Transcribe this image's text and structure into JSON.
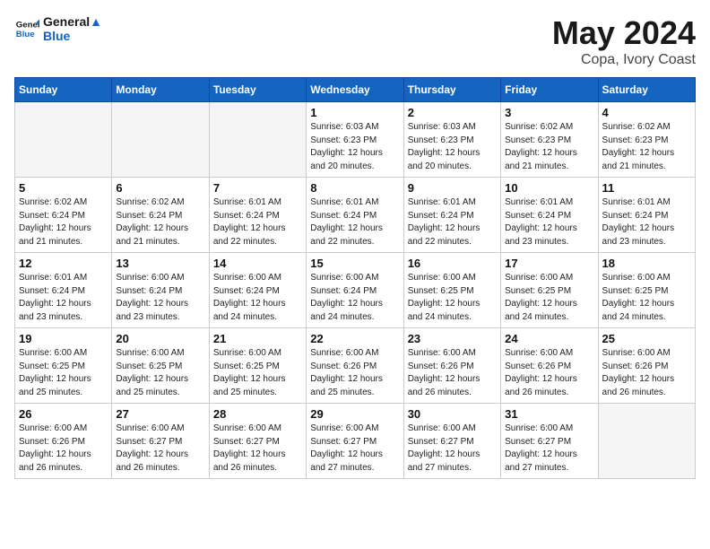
{
  "header": {
    "logo_line1": "General",
    "logo_line2": "Blue",
    "main_title": "May 2024",
    "sub_title": "Copa, Ivory Coast"
  },
  "weekdays": [
    "Sunday",
    "Monday",
    "Tuesday",
    "Wednesday",
    "Thursday",
    "Friday",
    "Saturday"
  ],
  "weeks": [
    [
      {
        "day": "",
        "info": ""
      },
      {
        "day": "",
        "info": ""
      },
      {
        "day": "",
        "info": ""
      },
      {
        "day": "1",
        "info": "Sunrise: 6:03 AM\nSunset: 6:23 PM\nDaylight: 12 hours\nand 20 minutes."
      },
      {
        "day": "2",
        "info": "Sunrise: 6:03 AM\nSunset: 6:23 PM\nDaylight: 12 hours\nand 20 minutes."
      },
      {
        "day": "3",
        "info": "Sunrise: 6:02 AM\nSunset: 6:23 PM\nDaylight: 12 hours\nand 21 minutes."
      },
      {
        "day": "4",
        "info": "Sunrise: 6:02 AM\nSunset: 6:23 PM\nDaylight: 12 hours\nand 21 minutes."
      }
    ],
    [
      {
        "day": "5",
        "info": "Sunrise: 6:02 AM\nSunset: 6:24 PM\nDaylight: 12 hours\nand 21 minutes."
      },
      {
        "day": "6",
        "info": "Sunrise: 6:02 AM\nSunset: 6:24 PM\nDaylight: 12 hours\nand 21 minutes."
      },
      {
        "day": "7",
        "info": "Sunrise: 6:01 AM\nSunset: 6:24 PM\nDaylight: 12 hours\nand 22 minutes."
      },
      {
        "day": "8",
        "info": "Sunrise: 6:01 AM\nSunset: 6:24 PM\nDaylight: 12 hours\nand 22 minutes."
      },
      {
        "day": "9",
        "info": "Sunrise: 6:01 AM\nSunset: 6:24 PM\nDaylight: 12 hours\nand 22 minutes."
      },
      {
        "day": "10",
        "info": "Sunrise: 6:01 AM\nSunset: 6:24 PM\nDaylight: 12 hours\nand 23 minutes."
      },
      {
        "day": "11",
        "info": "Sunrise: 6:01 AM\nSunset: 6:24 PM\nDaylight: 12 hours\nand 23 minutes."
      }
    ],
    [
      {
        "day": "12",
        "info": "Sunrise: 6:01 AM\nSunset: 6:24 PM\nDaylight: 12 hours\nand 23 minutes."
      },
      {
        "day": "13",
        "info": "Sunrise: 6:00 AM\nSunset: 6:24 PM\nDaylight: 12 hours\nand 23 minutes."
      },
      {
        "day": "14",
        "info": "Sunrise: 6:00 AM\nSunset: 6:24 PM\nDaylight: 12 hours\nand 24 minutes."
      },
      {
        "day": "15",
        "info": "Sunrise: 6:00 AM\nSunset: 6:24 PM\nDaylight: 12 hours\nand 24 minutes."
      },
      {
        "day": "16",
        "info": "Sunrise: 6:00 AM\nSunset: 6:25 PM\nDaylight: 12 hours\nand 24 minutes."
      },
      {
        "day": "17",
        "info": "Sunrise: 6:00 AM\nSunset: 6:25 PM\nDaylight: 12 hours\nand 24 minutes."
      },
      {
        "day": "18",
        "info": "Sunrise: 6:00 AM\nSunset: 6:25 PM\nDaylight: 12 hours\nand 24 minutes."
      }
    ],
    [
      {
        "day": "19",
        "info": "Sunrise: 6:00 AM\nSunset: 6:25 PM\nDaylight: 12 hours\nand 25 minutes."
      },
      {
        "day": "20",
        "info": "Sunrise: 6:00 AM\nSunset: 6:25 PM\nDaylight: 12 hours\nand 25 minutes."
      },
      {
        "day": "21",
        "info": "Sunrise: 6:00 AM\nSunset: 6:25 PM\nDaylight: 12 hours\nand 25 minutes."
      },
      {
        "day": "22",
        "info": "Sunrise: 6:00 AM\nSunset: 6:26 PM\nDaylight: 12 hours\nand 25 minutes."
      },
      {
        "day": "23",
        "info": "Sunrise: 6:00 AM\nSunset: 6:26 PM\nDaylight: 12 hours\nand 26 minutes."
      },
      {
        "day": "24",
        "info": "Sunrise: 6:00 AM\nSunset: 6:26 PM\nDaylight: 12 hours\nand 26 minutes."
      },
      {
        "day": "25",
        "info": "Sunrise: 6:00 AM\nSunset: 6:26 PM\nDaylight: 12 hours\nand 26 minutes."
      }
    ],
    [
      {
        "day": "26",
        "info": "Sunrise: 6:00 AM\nSunset: 6:26 PM\nDaylight: 12 hours\nand 26 minutes."
      },
      {
        "day": "27",
        "info": "Sunrise: 6:00 AM\nSunset: 6:27 PM\nDaylight: 12 hours\nand 26 minutes."
      },
      {
        "day": "28",
        "info": "Sunrise: 6:00 AM\nSunset: 6:27 PM\nDaylight: 12 hours\nand 26 minutes."
      },
      {
        "day": "29",
        "info": "Sunrise: 6:00 AM\nSunset: 6:27 PM\nDaylight: 12 hours\nand 27 minutes."
      },
      {
        "day": "30",
        "info": "Sunrise: 6:00 AM\nSunset: 6:27 PM\nDaylight: 12 hours\nand 27 minutes."
      },
      {
        "day": "31",
        "info": "Sunrise: 6:00 AM\nSunset: 6:27 PM\nDaylight: 12 hours\nand 27 minutes."
      },
      {
        "day": "",
        "info": ""
      }
    ]
  ]
}
